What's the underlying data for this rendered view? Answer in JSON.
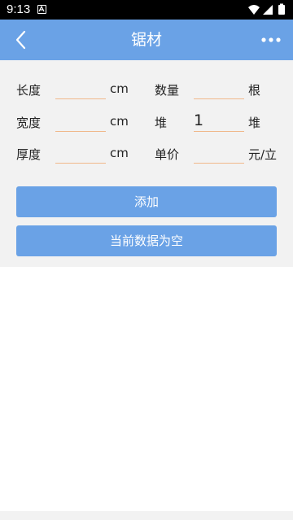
{
  "status_bar": {
    "time": "9:13",
    "icons": [
      "app-notification-icon",
      "wifi-icon",
      "signal-icon",
      "battery-icon"
    ]
  },
  "app_bar": {
    "title": "锯材",
    "back_icon": "chevron-left-icon",
    "more_icon": "more-horizontal-icon",
    "background": "#6aa2e6"
  },
  "form": {
    "length": {
      "label": "长度",
      "value": "",
      "unit": "cm"
    },
    "quantity": {
      "label": "数量",
      "value": "",
      "unit": "根"
    },
    "width": {
      "label": "宽度",
      "value": "",
      "unit": "cm"
    },
    "pile": {
      "label": "堆",
      "value": "1",
      "unit": "堆"
    },
    "thickness": {
      "label": "厚度",
      "value": "",
      "unit": "cm"
    },
    "unit_price": {
      "label": "单价",
      "value": "",
      "unit": "元/立"
    }
  },
  "buttons": {
    "add": "添加",
    "data_status": "当前数据为空"
  },
  "colors": {
    "accent": "#6aa2e6",
    "field_underline": "#f0b88a",
    "panel_bg": "#f2f2f2"
  }
}
